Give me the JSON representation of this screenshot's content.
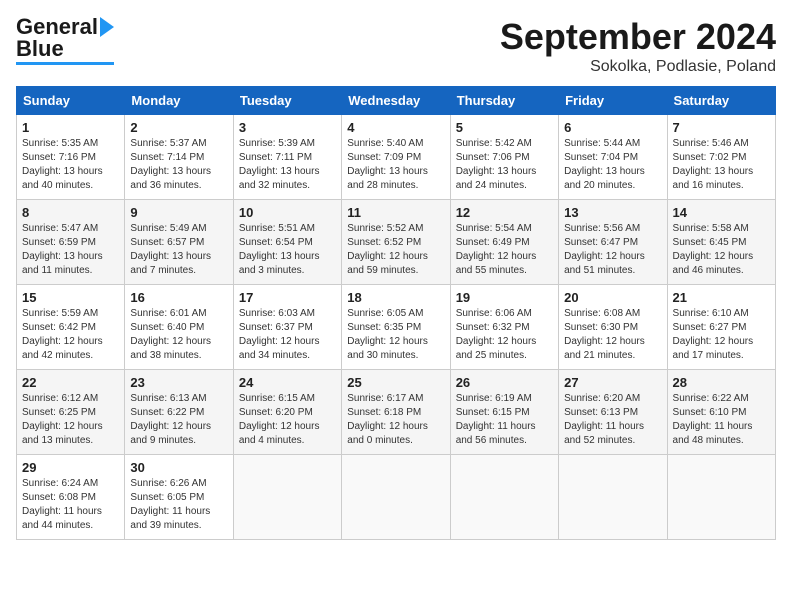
{
  "header": {
    "logo_general": "General",
    "logo_blue": "Blue",
    "month_title": "September 2024",
    "location": "Sokolka, Podlasie, Poland"
  },
  "days_of_week": [
    "Sunday",
    "Monday",
    "Tuesday",
    "Wednesday",
    "Thursday",
    "Friday",
    "Saturday"
  ],
  "weeks": [
    [
      {
        "num": "1",
        "detail": "Sunrise: 5:35 AM\nSunset: 7:16 PM\nDaylight: 13 hours\nand 40 minutes."
      },
      {
        "num": "2",
        "detail": "Sunrise: 5:37 AM\nSunset: 7:14 PM\nDaylight: 13 hours\nand 36 minutes."
      },
      {
        "num": "3",
        "detail": "Sunrise: 5:39 AM\nSunset: 7:11 PM\nDaylight: 13 hours\nand 32 minutes."
      },
      {
        "num": "4",
        "detail": "Sunrise: 5:40 AM\nSunset: 7:09 PM\nDaylight: 13 hours\nand 28 minutes."
      },
      {
        "num": "5",
        "detail": "Sunrise: 5:42 AM\nSunset: 7:06 PM\nDaylight: 13 hours\nand 24 minutes."
      },
      {
        "num": "6",
        "detail": "Sunrise: 5:44 AM\nSunset: 7:04 PM\nDaylight: 13 hours\nand 20 minutes."
      },
      {
        "num": "7",
        "detail": "Sunrise: 5:46 AM\nSunset: 7:02 PM\nDaylight: 13 hours\nand 16 minutes."
      }
    ],
    [
      {
        "num": "8",
        "detail": "Sunrise: 5:47 AM\nSunset: 6:59 PM\nDaylight: 13 hours\nand 11 minutes."
      },
      {
        "num": "9",
        "detail": "Sunrise: 5:49 AM\nSunset: 6:57 PM\nDaylight: 13 hours\nand 7 minutes."
      },
      {
        "num": "10",
        "detail": "Sunrise: 5:51 AM\nSunset: 6:54 PM\nDaylight: 13 hours\nand 3 minutes."
      },
      {
        "num": "11",
        "detail": "Sunrise: 5:52 AM\nSunset: 6:52 PM\nDaylight: 12 hours\nand 59 minutes."
      },
      {
        "num": "12",
        "detail": "Sunrise: 5:54 AM\nSunset: 6:49 PM\nDaylight: 12 hours\nand 55 minutes."
      },
      {
        "num": "13",
        "detail": "Sunrise: 5:56 AM\nSunset: 6:47 PM\nDaylight: 12 hours\nand 51 minutes."
      },
      {
        "num": "14",
        "detail": "Sunrise: 5:58 AM\nSunset: 6:45 PM\nDaylight: 12 hours\nand 46 minutes."
      }
    ],
    [
      {
        "num": "15",
        "detail": "Sunrise: 5:59 AM\nSunset: 6:42 PM\nDaylight: 12 hours\nand 42 minutes."
      },
      {
        "num": "16",
        "detail": "Sunrise: 6:01 AM\nSunset: 6:40 PM\nDaylight: 12 hours\nand 38 minutes."
      },
      {
        "num": "17",
        "detail": "Sunrise: 6:03 AM\nSunset: 6:37 PM\nDaylight: 12 hours\nand 34 minutes."
      },
      {
        "num": "18",
        "detail": "Sunrise: 6:05 AM\nSunset: 6:35 PM\nDaylight: 12 hours\nand 30 minutes."
      },
      {
        "num": "19",
        "detail": "Sunrise: 6:06 AM\nSunset: 6:32 PM\nDaylight: 12 hours\nand 25 minutes."
      },
      {
        "num": "20",
        "detail": "Sunrise: 6:08 AM\nSunset: 6:30 PM\nDaylight: 12 hours\nand 21 minutes."
      },
      {
        "num": "21",
        "detail": "Sunrise: 6:10 AM\nSunset: 6:27 PM\nDaylight: 12 hours\nand 17 minutes."
      }
    ],
    [
      {
        "num": "22",
        "detail": "Sunrise: 6:12 AM\nSunset: 6:25 PM\nDaylight: 12 hours\nand 13 minutes."
      },
      {
        "num": "23",
        "detail": "Sunrise: 6:13 AM\nSunset: 6:22 PM\nDaylight: 12 hours\nand 9 minutes."
      },
      {
        "num": "24",
        "detail": "Sunrise: 6:15 AM\nSunset: 6:20 PM\nDaylight: 12 hours\nand 4 minutes."
      },
      {
        "num": "25",
        "detail": "Sunrise: 6:17 AM\nSunset: 6:18 PM\nDaylight: 12 hours\nand 0 minutes."
      },
      {
        "num": "26",
        "detail": "Sunrise: 6:19 AM\nSunset: 6:15 PM\nDaylight: 11 hours\nand 56 minutes."
      },
      {
        "num": "27",
        "detail": "Sunrise: 6:20 AM\nSunset: 6:13 PM\nDaylight: 11 hours\nand 52 minutes."
      },
      {
        "num": "28",
        "detail": "Sunrise: 6:22 AM\nSunset: 6:10 PM\nDaylight: 11 hours\nand 48 minutes."
      }
    ],
    [
      {
        "num": "29",
        "detail": "Sunrise: 6:24 AM\nSunset: 6:08 PM\nDaylight: 11 hours\nand 44 minutes."
      },
      {
        "num": "30",
        "detail": "Sunrise: 6:26 AM\nSunset: 6:05 PM\nDaylight: 11 hours\nand 39 minutes."
      },
      {
        "num": "",
        "detail": ""
      },
      {
        "num": "",
        "detail": ""
      },
      {
        "num": "",
        "detail": ""
      },
      {
        "num": "",
        "detail": ""
      },
      {
        "num": "",
        "detail": ""
      }
    ]
  ]
}
